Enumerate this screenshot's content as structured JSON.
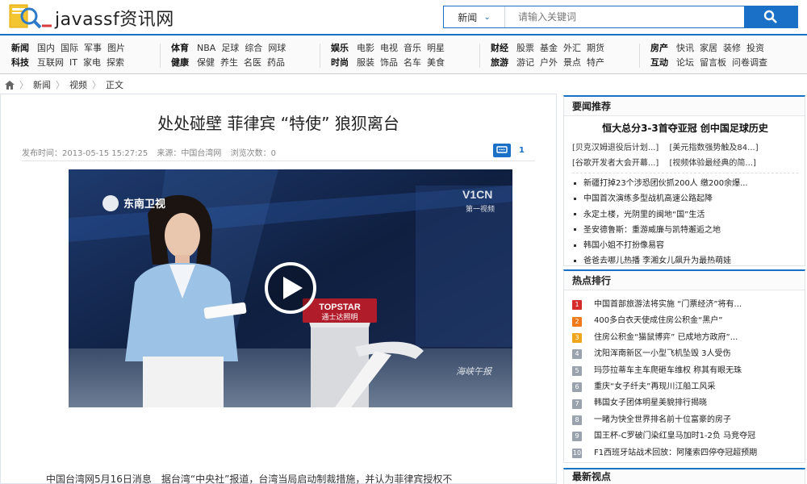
{
  "header": {
    "site_title": "javassf资讯网",
    "search_category": "新闻",
    "search_placeholder": "请输入关键词"
  },
  "nav": {
    "groups": [
      {
        "rows": [
          {
            "head": "新闻",
            "items": [
              "国内",
              "国际",
              "军事",
              "图片"
            ]
          },
          {
            "head": "科技",
            "items": [
              "互联网",
              "IT",
              "家电",
              "探索"
            ]
          }
        ]
      },
      {
        "rows": [
          {
            "head": "体育",
            "items": [
              "NBA",
              "足球",
              "综合",
              "网球"
            ]
          },
          {
            "head": "健康",
            "items": [
              "保健",
              "养生",
              "名医",
              "药品"
            ]
          }
        ]
      },
      {
        "rows": [
          {
            "head": "娱乐",
            "items": [
              "电影",
              "电视",
              "音乐",
              "明星"
            ]
          },
          {
            "head": "时尚",
            "items": [
              "服装",
              "饰品",
              "名车",
              "美食"
            ]
          }
        ]
      },
      {
        "rows": [
          {
            "head": "财经",
            "items": [
              "股票",
              "基金",
              "外汇",
              "期货"
            ]
          },
          {
            "head": "旅游",
            "items": [
              "游记",
              "户外",
              "景点",
              "特产"
            ]
          }
        ]
      },
      {
        "rows": [
          {
            "head": "房产",
            "items": [
              "快讯",
              "家居",
              "装修",
              "投资"
            ]
          },
          {
            "head": "互动",
            "items": [
              "论坛",
              "留言板",
              "问卷调查"
            ]
          }
        ]
      }
    ]
  },
  "breadcrumb": [
    "新闻",
    "视频",
    "正文"
  ],
  "article": {
    "title": "处处碰壁 菲律宾 “特使” 狼狈离台",
    "publish_time": "发布时间：2013-05-15 15:27:25",
    "source": "来源：中国台湾网",
    "views": "浏览次数：0",
    "comment_count": "1",
    "body_start": "中国台湾网5月16日消息　据台湾“中央社”报道，台湾当局启动制裁措施，并认为菲律宾授权不"
  },
  "video": {
    "channel_logo": "东南卫视",
    "corner_logo": "V1CN",
    "corner_sub": "第一视频",
    "podium_brand": "TOPSTAR",
    "podium_sub": "通士达照明",
    "program_name": "海峡午报"
  },
  "sidebar": {
    "featured": {
      "heading": "要闻推荐",
      "headline": "恒大总分3-3首夺亚冠 创中国足球历史",
      "sub_links": [
        [
          "[贝克汉姆退役后计划...]",
          "[美元指数强势触及84...]"
        ],
        [
          "[谷歌开发者大会开幕...]",
          "[视频体验最经典的简...]"
        ]
      ],
      "news": [
        "新疆打掉23个涉恐团伙抓200人 缴200余爆...",
        "中国首次演练多型战机高速公路起降",
        "永定土楼，光阴里的闽地“国”生活",
        "圣安德鲁斯：重游威廉与凯特邂逅之地",
        "韩国小姐不打扮像易容",
        "爸爸去哪儿热播 李湘女儿飙升为最热萌娃"
      ]
    },
    "hot": {
      "heading": "热点排行",
      "items": [
        "中国首部旅游法将实施 “门票经济”将有...",
        "400多白衣天使成住房公积金“黑户”",
        "住房公积金“猫鼠博弈” 已成地方政府”...",
        "沈阳浑南新区一小型飞机坠毁 3人受伤",
        "玛莎拉蒂车主车爬砸车维权 称其有眼无珠",
        "重庆“女子纤夫”再现川江船工风采",
        "韩国女子团体明星美貌排行揭晓",
        "一睹为快全世界排名前十位富豪的房子",
        "国王杯-C罗破门染红皇马加时1-2负 马竞夺冠",
        "F1西班牙站战术回放：阿隆索四停夺冠超预期"
      ],
      "rank_colors": [
        "#d52b2b",
        "#f07a1a",
        "#f0a51a",
        "#9aa3ad"
      ]
    },
    "latest": {
      "heading": "最新视点"
    }
  },
  "colors": {
    "accent": "#1a6fc7"
  }
}
